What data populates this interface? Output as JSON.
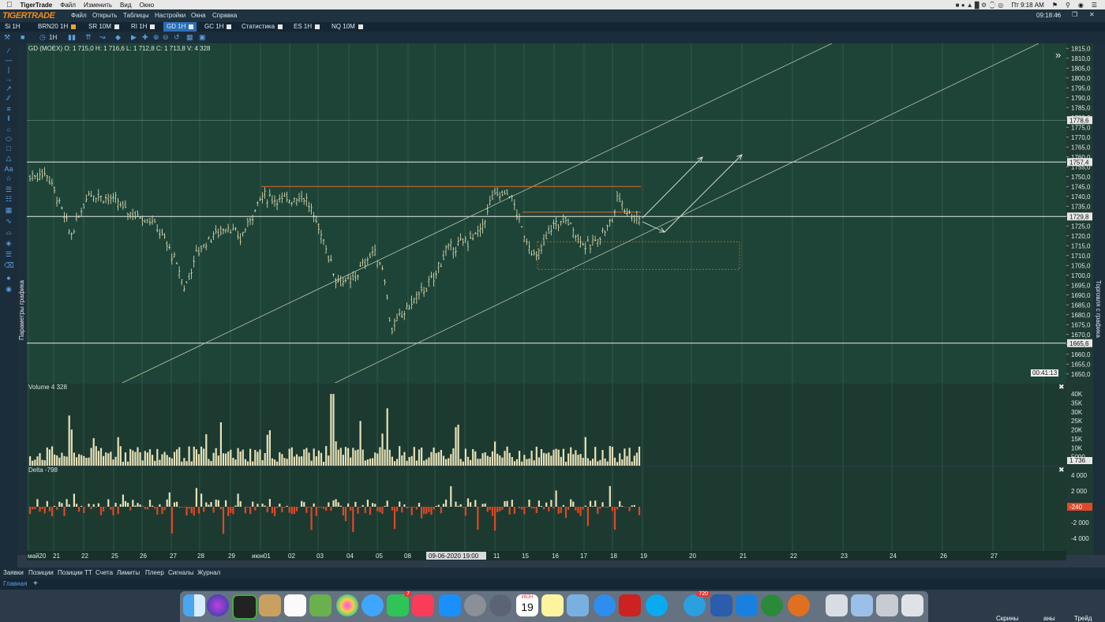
{
  "menubar": {
    "app": "TigerTrade",
    "items": [
      "Файл",
      "Изменить",
      "Вид",
      "Окно"
    ],
    "time": "Пт 9:18 AM"
  },
  "titlebar": {
    "logo": "TIGERTRADE",
    "menu": [
      "Файл",
      "Открыть",
      "Таблицы",
      "Настройки",
      "Окна",
      "Справка"
    ],
    "clock": "09:18:46"
  },
  "tabs": [
    {
      "label": "Si 1H",
      "color": ""
    },
    {
      "label": "BRN20 1H",
      "color": "#f0a030"
    },
    {
      "label": "SR 10M",
      "color": "#e8e8e8"
    },
    {
      "label": "RI 1H",
      "color": "#e8e8e8"
    },
    {
      "label": "GD 1H",
      "color": "#e8e8e8",
      "active": true
    },
    {
      "label": "GC 1H",
      "color": "#e8e8e8"
    },
    {
      "label": "Статистика",
      "color": "#e8e8e8"
    },
    {
      "label": "ES 1H",
      "color": "#e8e8e8"
    },
    {
      "label": "NQ 10M",
      "color": "#e8e8e8"
    }
  ],
  "toolbar": {
    "timeframe": "1H",
    "symbol_tab": "GD 1H"
  },
  "chart": {
    "info": "GD (MOEX) O: 1 715,0 H: 1 716,6 L: 1 712,8 C: 1 713,8 V: 4 328",
    "timer": "00:41:13",
    "left_panel_label": "Параметры графика",
    "right_panel_label": "Торговля с графика",
    "price_ticks": [
      "1815,0",
      "1810,0",
      "1805,0",
      "1800,0",
      "1795,0",
      "1790,0",
      "1785,0",
      "1780,0",
      "1775,0",
      "1770,0",
      "1765,0",
      "1760,0",
      "1755,0",
      "1750,0",
      "1745,0",
      "1740,0",
      "1735,0",
      "1730,0",
      "1725,0",
      "1720,0",
      "1715,0",
      "1710,0",
      "1705,0",
      "1700,0",
      "1695,0",
      "1690,0",
      "1685,0",
      "1680,0",
      "1675,0",
      "1670,0",
      "1665,0",
      "1660,0",
      "1655,0",
      "1650,0"
    ],
    "price_tags": [
      {
        "label": "1778,6",
        "value": 1778.6
      },
      {
        "label": "1757,4",
        "value": 1757.4
      },
      {
        "label": "1729,8",
        "value": 1729.8
      },
      {
        "label": "1665,6",
        "value": 1665.6
      }
    ],
    "date_ticks": [
      "май20",
      "21",
      "22",
      "25",
      "26",
      "27",
      "28",
      "29",
      "июн01",
      "02",
      "03",
      "04",
      "05",
      "08",
      "09-06-2020 19:00",
      "11",
      "15",
      "16",
      "17",
      "18",
      "19",
      "20",
      "21",
      "22",
      "23",
      "24",
      "26",
      "27"
    ],
    "colors": {
      "up": "#e7e2b8",
      "down": "#e04828",
      "level": "#e8e8e8",
      "resistance": "#e0682a",
      "channel": "#b9c2a6"
    }
  },
  "volume": {
    "title": "Volume 4 328",
    "ticks": [
      "40K",
      "35K",
      "30K",
      "25K",
      "20K",
      "15K",
      "10K",
      "5000"
    ],
    "last": "1 736"
  },
  "delta": {
    "title": "Delta -798",
    "ticks": [
      "4 000",
      "2 000",
      "-2 000",
      "-4 000"
    ],
    "last": "-240"
  },
  "bottom_tabs": [
    "Заявки",
    "Позиции",
    "Позиции TT",
    "Счета",
    "Лимиты",
    "Плеер",
    "Сигналы",
    "Журнал"
  ],
  "workspace_tab": "Главная",
  "dock": {
    "calendar_month": "ИЮН",
    "calendar_day": "19",
    "badges": [
      {
        "app": "facetime",
        "count": "7"
      },
      {
        "app": "telegram",
        "count": "720"
      }
    ],
    "right_labels": [
      "Скрины",
      "аны",
      "Трейд"
    ]
  }
}
